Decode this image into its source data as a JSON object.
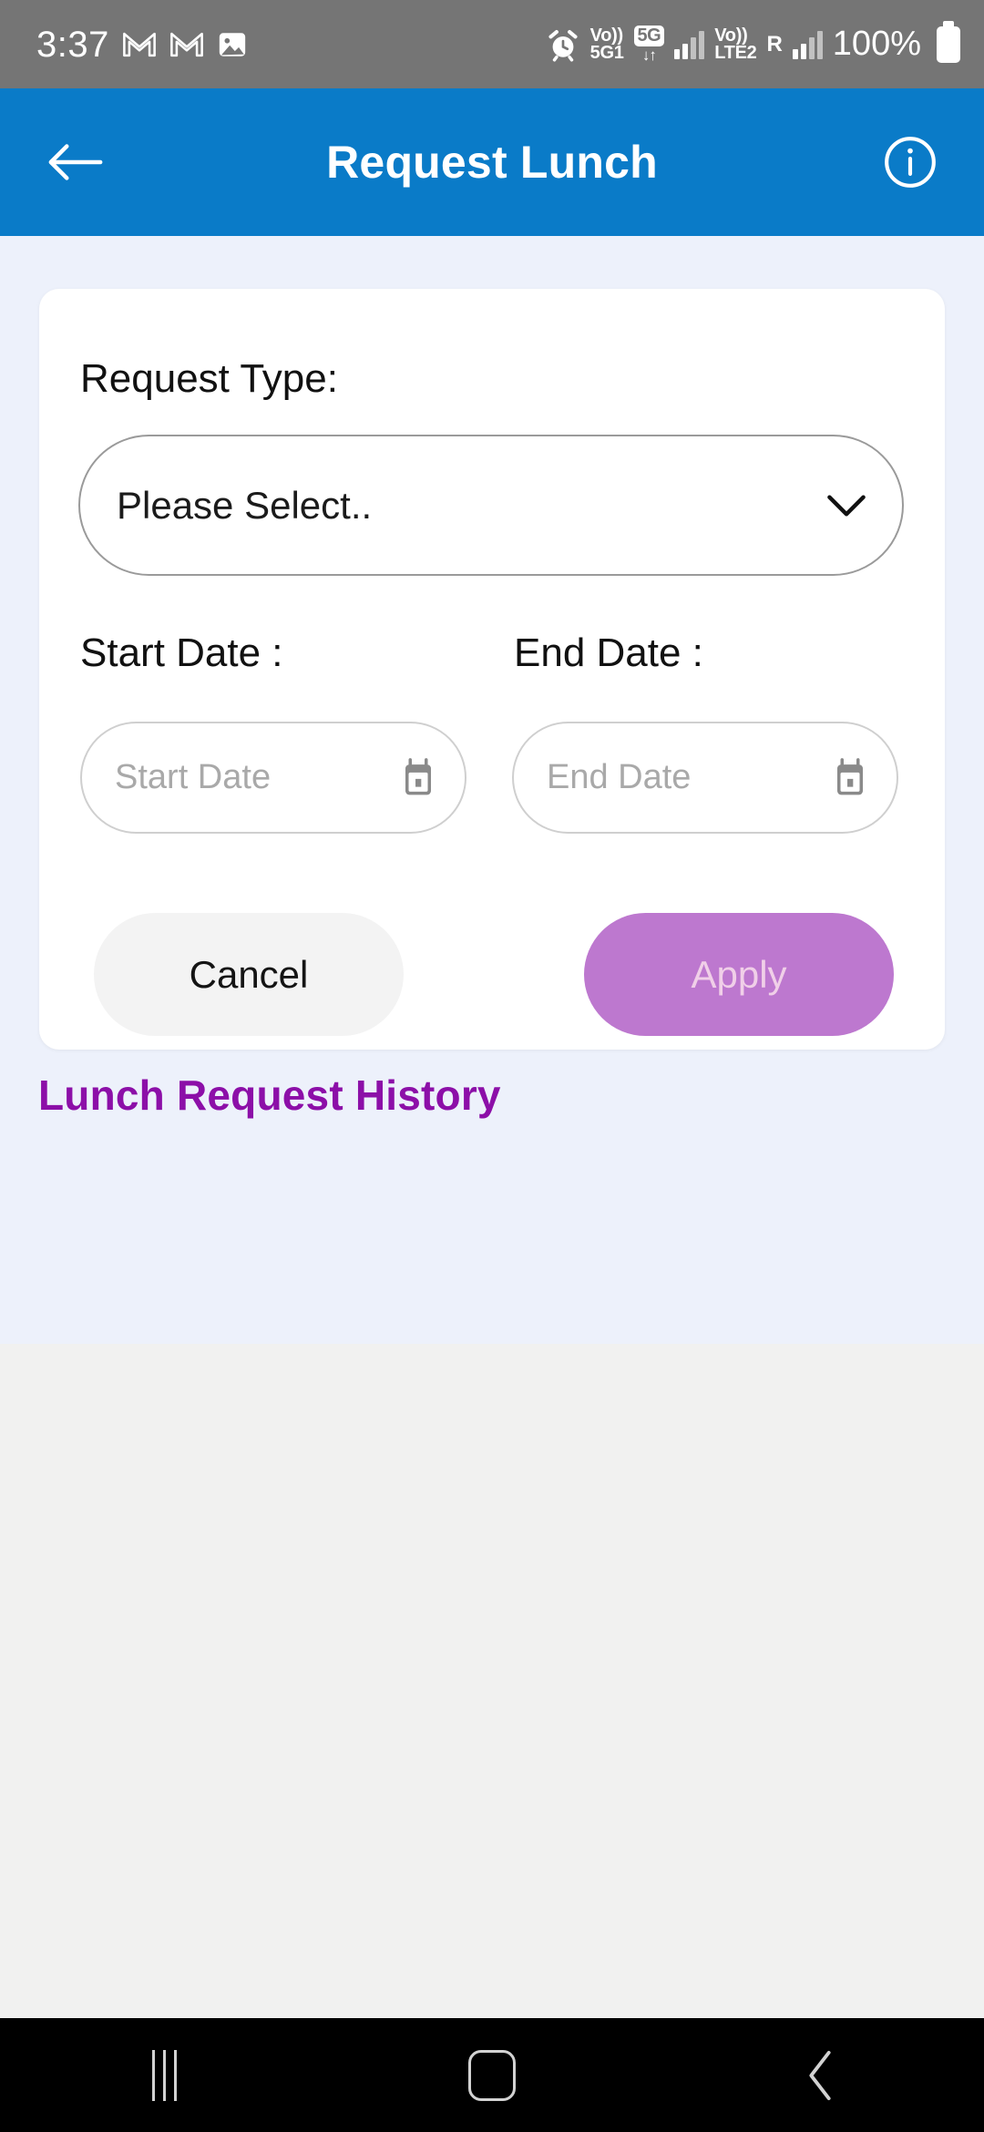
{
  "status_bar": {
    "time": "3:37",
    "left_icons": [
      "gmail-icon",
      "gmail-icon",
      "photos-icon"
    ],
    "alarm_icon": "alarm-icon",
    "sim1_volte": "Vo))",
    "sim1_network": "5G1",
    "network_badge": "5G",
    "network_arrows": "↓↑",
    "sim2_volte": "Vo))",
    "sim2_network": "LTE2",
    "roaming": "R",
    "battery_percent": "100%",
    "battery_icon": "battery-full-icon",
    "background_color": "#757575"
  },
  "app_bar": {
    "title": "Request Lunch",
    "back_icon": "back-arrow-icon",
    "info_icon": "info-circle-icon",
    "background_color": "#0a7bc8"
  },
  "form": {
    "request_type_label": "Request Type:",
    "request_type_value": "Please Select..",
    "request_type_chevron": "chevron-down-icon",
    "start_date_label": "Start Date :",
    "start_date_value": "",
    "start_date_placeholder": "Start Date",
    "start_date_icon": "calendar-icon",
    "end_date_label": "End Date :",
    "end_date_value": "",
    "end_date_placeholder": "End Date",
    "end_date_icon": "calendar-icon",
    "cancel_label": "Cancel",
    "apply_label": "Apply",
    "apply_color": "#bd78cf",
    "cancel_color": "#f3f3f3"
  },
  "history": {
    "title": "Lunch Request History",
    "title_color": "#8c0fa8"
  },
  "nav_bar": {
    "recents_icon": "recents-icon",
    "home_icon": "home-icon",
    "back_icon": "back-chevron-icon",
    "background_color": "#000000"
  }
}
